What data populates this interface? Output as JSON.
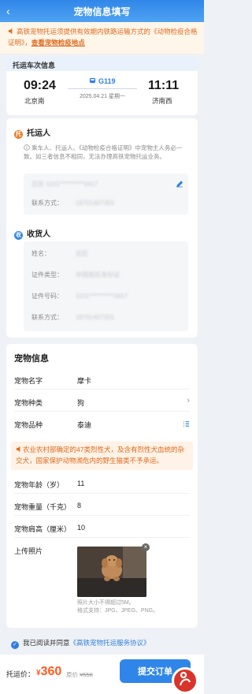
{
  "header": {
    "back_glyph": "‹",
    "title": "宠物信息填写"
  },
  "notice": {
    "text": "高铁宠物托运须提供有效期内铁路运输方式的《动物检疫合格证明》，",
    "link": "查看宠物检疫地点"
  },
  "train": {
    "section_title": "托运车次信息",
    "dep_time": "09:24",
    "dep_station": "北京南",
    "train_no": "G119",
    "date": "2025.04.21 星期一",
    "arr_time": "11:11",
    "arr_station": "济南西"
  },
  "consignor": {
    "title": "托运人",
    "badge": "托",
    "tip": "乘车人、托运人、《动物检疫合格证明》中宠物主人务必一致。如三者信息不相同，无法办理高铁宠物托运业务。",
    "name_row": "吕民 1101**********3417",
    "phone_label": "联系方式：",
    "phone_value": "18701407355"
  },
  "consignee": {
    "title": "收货人",
    "badge": "收",
    "name_label": "姓名：",
    "name_value": "吕民",
    "idtype_label": "证件类型：",
    "idtype_value": "中国居民身份证",
    "idno_label": "证件号码：",
    "idno_value": "1101**********3417",
    "phone_label": "联系方式：",
    "phone_value": "18701407355"
  },
  "pet": {
    "title": "宠物信息",
    "name_label": "宠物名字",
    "name_value": "摩卡",
    "type_label": "宠物种类",
    "type_value": "狗",
    "breed_label": "宠物品种",
    "breed_value": "泰迪",
    "warning": "农业农村部确定的47类烈性犬，及含有烈性犬血统的杂交犬，国家保护动物濒危内的野生猫类不予承运。",
    "age_label": "宠物年龄（岁）",
    "age_value": "11",
    "weight_label": "宠物重量（千克）",
    "weight_value": "8",
    "height_label": "宠物肩高（厘米）",
    "height_value": "10",
    "photo_label": "上传照片",
    "photo_hint_1": "照片大小不得超过5M。",
    "photo_hint_2": "格式支持：JPG、JPEG、PNG。"
  },
  "agree": {
    "prefix": "我已阅读并同意",
    "link": "《高铁宠物托运服务协议》"
  },
  "footer": {
    "price_label": "托运价：",
    "price_symbol": "¥",
    "price": "360",
    "orig_label": "原价",
    "orig_price": "¥558",
    "submit": "提交订单"
  },
  "colors": {
    "primary": "#2f86e8",
    "orange": "#e06a1d",
    "price": "#ff5a1f"
  }
}
